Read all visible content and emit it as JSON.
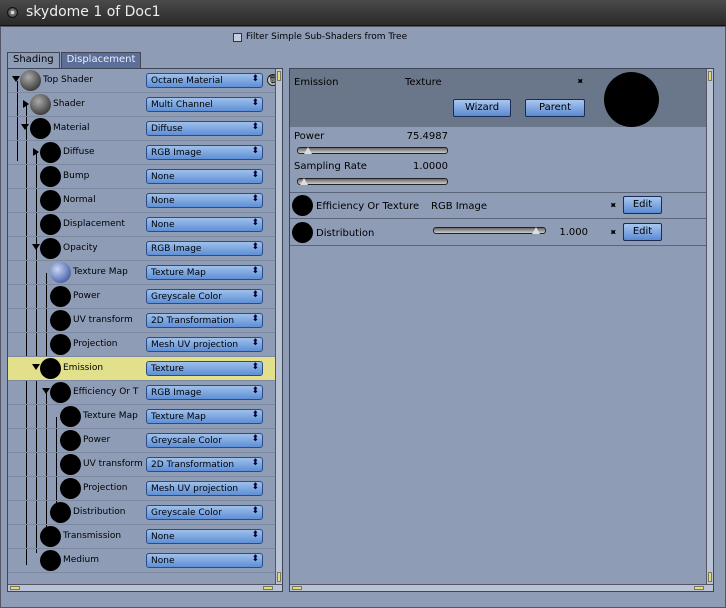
{
  "window": {
    "title": "skydome 1 of Doc1"
  },
  "filter": {
    "label": "Filter Simple Sub-Shaders from Tree",
    "checked": false
  },
  "tabs": [
    {
      "label": "Shading"
    },
    {
      "label": "Displacement"
    }
  ],
  "tree": [
    {
      "label": "Top Shader",
      "value": "Octane Material"
    },
    {
      "label": "Shader",
      "value": "Multi Channel"
    },
    {
      "label": "Material",
      "value": "Diffuse"
    },
    {
      "label": "Diffuse",
      "value": "RGB Image"
    },
    {
      "label": "Bump",
      "value": "None"
    },
    {
      "label": "Normal",
      "value": "None"
    },
    {
      "label": "Displacement",
      "value": "None"
    },
    {
      "label": "Opacity",
      "value": "RGB Image"
    },
    {
      "label": "Texture Map",
      "value": "Texture Map"
    },
    {
      "label": "Power",
      "value": "Greyscale Color"
    },
    {
      "label": "UV transform",
      "value": "2D Transformation"
    },
    {
      "label": "Projection",
      "value": "Mesh UV projection"
    },
    {
      "label": "Emission",
      "value": "Texture"
    },
    {
      "label": "Efficiency Or T",
      "value": "RGB Image"
    },
    {
      "label": "Texture Map",
      "value": "Texture Map"
    },
    {
      "label": "Power",
      "value": "Greyscale Color"
    },
    {
      "label": "UV transform",
      "value": "2D Transformation"
    },
    {
      "label": "Projection",
      "value": "Mesh UV projection"
    },
    {
      "label": "Distribution",
      "value": "Greyscale Color"
    },
    {
      "label": "Transmission",
      "value": "None"
    },
    {
      "label": "Medium",
      "value": "None"
    }
  ],
  "emission": {
    "label": "Emission",
    "type": "Texture",
    "wizard_label": "Wizard",
    "parent_label": "Parent"
  },
  "params": {
    "power_label": "Power",
    "power_value": "75.4987",
    "sampling_label": "Sampling Rate",
    "sampling_value": "1.0000",
    "efficiency_label": "Efficiency Or Texture",
    "efficiency_value": "RGB Image",
    "efficiency_edit": "Edit",
    "distribution_label": "Distribution",
    "distribution_value": "1.000",
    "distribution_edit": "Edit"
  },
  "colors": {
    "panel": "#8e9cb6",
    "selected_row": "#e3e08c",
    "dropdown": "#7aa6e2",
    "header": "#6a768a"
  }
}
